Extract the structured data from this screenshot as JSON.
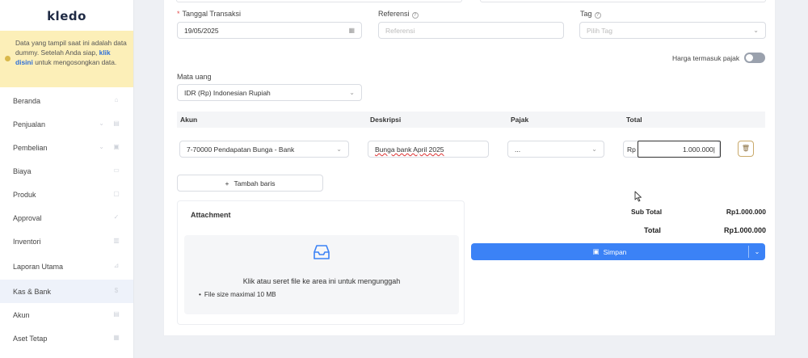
{
  "app": {
    "logo": "kledo"
  },
  "notice": {
    "text_before": "Data yang tampil saat ini adalah data dummy. Setelah Anda siap,",
    "link": "klik disini",
    "text_after": "untuk mengosongkan data."
  },
  "sidebar": {
    "items": [
      {
        "label": "Beranda",
        "icon": "home-icon"
      },
      {
        "label": "Penjualan",
        "icon": "basket-icon",
        "expandable": true
      },
      {
        "label": "Pembelian",
        "icon": "bag-icon",
        "expandable": true
      },
      {
        "label": "Biaya",
        "icon": "card-icon"
      },
      {
        "label": "Produk",
        "icon": "box-icon"
      },
      {
        "label": "Approval",
        "icon": "check-icon"
      },
      {
        "label": "Inventori",
        "icon": "warehouse-icon"
      },
      {
        "label": "Laporan Utama",
        "icon": "chart-icon"
      },
      {
        "label": "Kas & Bank",
        "icon": "dollar-icon",
        "active": true
      },
      {
        "label": "Akun",
        "icon": "ledger-icon"
      },
      {
        "label": "Aset Tetap",
        "icon": "building-icon"
      }
    ]
  },
  "form": {
    "tanggal_label": "Tanggal Transaksi",
    "tanggal_required": "*",
    "tanggal_value": "19/05/2025",
    "referensi_label": "Referensi",
    "referensi_placeholder": "Referensi",
    "tag_label": "Tag",
    "tag_placeholder": "Pilih Tag",
    "harga_pajak_label": "Harga termasuk pajak",
    "mata_uang_label": "Mata uang",
    "mata_uang_value": "IDR (Rp) Indonesian Rupiah"
  },
  "table": {
    "headers": {
      "akun": "Akun",
      "deskripsi": "Deskripsi",
      "pajak": "Pajak",
      "total": "Total"
    },
    "rows": [
      {
        "akun": "7-70000 Pendapatan Bunga - Bank",
        "deskripsi": "Bunga bank April 2025",
        "pajak": "...",
        "currency": "Rp",
        "total": "1.000.000"
      }
    ],
    "add_row_label": "Tambah baris"
  },
  "attachment": {
    "title": "Attachment",
    "dropzone_text": "Klik atau seret file ke area ini untuk mengunggah",
    "note": "File size maximal 10 MB"
  },
  "summary": {
    "subtotal_label": "Sub Total",
    "subtotal_value": "Rp1.000.000",
    "total_label": "Total",
    "total_value": "Rp1.000.000"
  },
  "actions": {
    "save_label": "Simpan"
  },
  "colors": {
    "primary": "#3b82f6",
    "notice_bg": "#fcefb8",
    "active_nav": "#eef2fa"
  }
}
